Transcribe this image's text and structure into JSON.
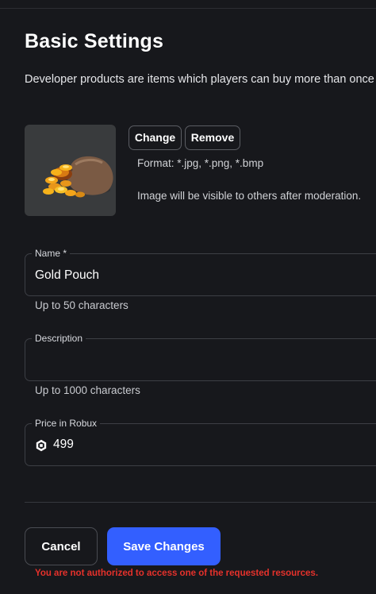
{
  "header": {
    "title": "Basic Settings",
    "description": "Developer products are items which players can buy more than once"
  },
  "image": {
    "change_label": "Change",
    "remove_label": "Remove",
    "format_hint": "Format: *.jpg, *.png, *.bmp",
    "moderation_hint": "Image will be visible to others after moderation.",
    "thumbnail_icon": "gold-pouch-thumbnail"
  },
  "form": {
    "name": {
      "label": "Name *",
      "value": "Gold Pouch",
      "helper": "Up to 50 characters"
    },
    "description": {
      "label": "Description",
      "value": "",
      "helper": "Up to 1000 characters"
    },
    "price": {
      "label": "Price in Robux",
      "value": "499",
      "icon": "robux-icon"
    }
  },
  "actions": {
    "cancel_label": "Cancel",
    "save_label": "Save Changes",
    "error": "You are not authorized to access one of the requested resources."
  },
  "colors": {
    "background": "#17181c",
    "primary": "#335fff",
    "error": "#e5312b",
    "thumbnail_bg": "#393b3d"
  }
}
